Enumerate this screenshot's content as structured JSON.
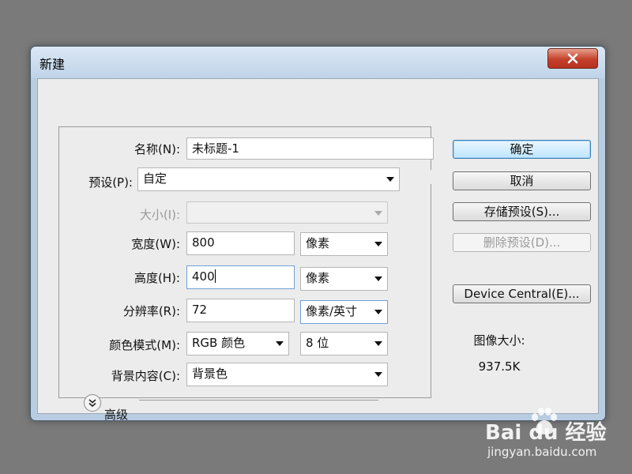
{
  "window": {
    "title": "新建"
  },
  "form": {
    "name_label": "名称(N):",
    "name_value": "未标题-1",
    "preset_label": "预设(P):",
    "preset_value": "自定",
    "size_label": "大小(I):",
    "size_value": "",
    "width_label": "宽度(W):",
    "width_value": "800",
    "width_unit": "像素",
    "height_label": "高度(H):",
    "height_value": "400",
    "height_unit": "像素",
    "resolution_label": "分辨率(R):",
    "resolution_value": "72",
    "resolution_unit": "像素/英寸",
    "color_mode_label": "颜色模式(M):",
    "color_mode_value": "RGB 颜色",
    "bit_depth_value": "8 位",
    "background_label": "背景内容(C):",
    "background_value": "背景色",
    "advanced_label": "高级"
  },
  "buttons": {
    "ok": "确定",
    "cancel": "取消",
    "save_preset": "存储预设(S)...",
    "delete_preset": "删除预设(D)...",
    "device_central": "Device Central(E)..."
  },
  "image_size": {
    "label": "图像大小:",
    "value": "937.5K"
  },
  "watermark": {
    "brand": "Bai du 经验",
    "url": "jingyan.baidu.com"
  },
  "colors": {
    "titlebar": "#c9dcef",
    "close_button": "#c4402a",
    "dialog_bg": "#ececec"
  },
  "icons": {
    "close": "close-icon",
    "expand": "double-chevron-down-icon"
  }
}
